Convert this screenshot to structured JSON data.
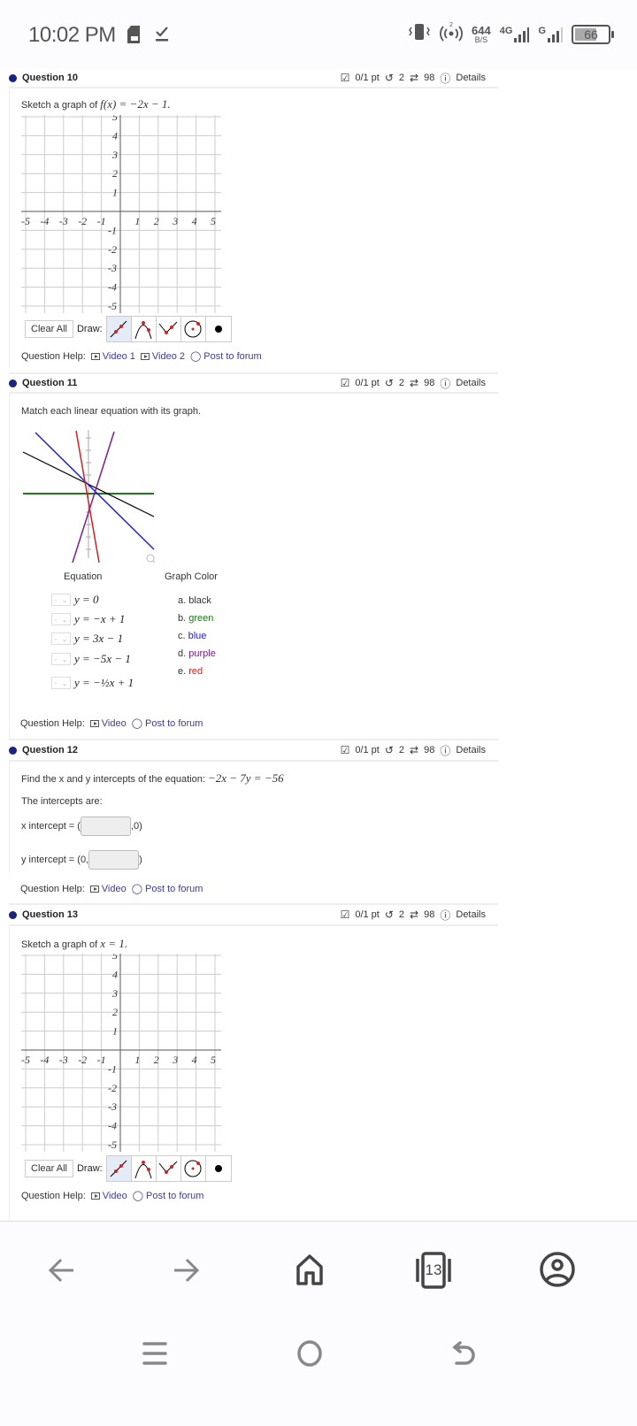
{
  "status_bar": {
    "time": "10:02 PM",
    "net_speed_value": "644",
    "net_speed_unit": "B/S",
    "network_4g": "4G",
    "network_g": "G",
    "battery": "66"
  },
  "questions": [
    {
      "title": "Question 10",
      "score": "0/1 pt",
      "retries": "2",
      "attempts": "98",
      "details_label": "Details",
      "prompt_text": "Sketch a graph of ",
      "prompt_math": "f(x) = −2x − 1.",
      "graph": {
        "x_ticks": [
          "-5",
          "-4",
          "-3",
          "-2",
          "-1",
          "1",
          "2",
          "3",
          "4",
          "5"
        ],
        "y_ticks": [
          "5",
          "4",
          "3",
          "2",
          "1",
          "-1",
          "-2",
          "-3",
          "-4",
          "-5"
        ]
      },
      "clear_all_label": "Clear All",
      "draw_label": "Draw:",
      "draw_tools": [
        "line-tool",
        "parabola-tool",
        "absolute-value-tool",
        "circle-tool",
        "point-tool"
      ],
      "help_label": "Question Help:",
      "help_links": [
        "Video 1",
        "Video 2",
        "Post to forum"
      ]
    },
    {
      "title": "Question 11",
      "score": "0/1 pt",
      "retries": "2",
      "attempts": "98",
      "details_label": "Details",
      "prompt_text": "Match each linear equation with its graph.",
      "equation_header": "Equation",
      "color_header": "Graph Color",
      "equations": [
        "y = 0",
        "y = −x + 1",
        "y = 3x − 1",
        "y = −5x − 1",
        "y = −½x + 1"
      ],
      "select_placeholder": "-",
      "colors": [
        {
          "letter": "a.",
          "name": "black",
          "hex": "#000000"
        },
        {
          "letter": "b.",
          "name": "green",
          "hex": "#1b7a1b"
        },
        {
          "letter": "c.",
          "name": "blue",
          "hex": "#2222cc"
        },
        {
          "letter": "d.",
          "name": "purple",
          "hex": "#7a1f8a"
        },
        {
          "letter": "e.",
          "name": "red",
          "hex": "#d32020"
        }
      ],
      "help_label": "Question Help:",
      "help_links": [
        "Video",
        "Post to forum"
      ]
    },
    {
      "title": "Question 12",
      "score": "0/1 pt",
      "retries": "2",
      "attempts": "98",
      "details_label": "Details",
      "prompt_text": "Find the x and y intercepts of the equation: ",
      "prompt_math": "−2x − 7y = −56",
      "intercepts_label": "The intercepts are:",
      "x_intercept_label": "x intercept = (",
      "x_intercept_suffix": ",0)",
      "x_intercept_value": "",
      "y_intercept_label": "y intercept = (0,",
      "y_intercept_suffix": ")",
      "y_intercept_value": "",
      "help_label": "Question Help:",
      "help_links": [
        "Video",
        "Post to forum"
      ]
    },
    {
      "title": "Question 13",
      "score": "0/1 pt",
      "retries": "2",
      "attempts": "98",
      "details_label": "Details",
      "prompt_text": "Sketch a graph of ",
      "prompt_math": "x = 1.",
      "graph": {
        "x_ticks": [
          "-5",
          "-4",
          "-3",
          "-2",
          "-1",
          "1",
          "2",
          "3",
          "4",
          "5"
        ],
        "y_ticks": [
          "5",
          "4",
          "3",
          "2",
          "1",
          "-1",
          "-2",
          "-3",
          "-4",
          "-5"
        ]
      },
      "clear_all_label": "Clear All",
      "draw_label": "Draw:",
      "draw_tools": [
        "line-tool",
        "parabola-tool",
        "absolute-value-tool",
        "circle-tool",
        "point-tool"
      ],
      "help_label": "Question Help:",
      "help_links": [
        "Video",
        "Post to forum"
      ]
    }
  ],
  "browser_nav": {
    "tab_count": "13"
  }
}
